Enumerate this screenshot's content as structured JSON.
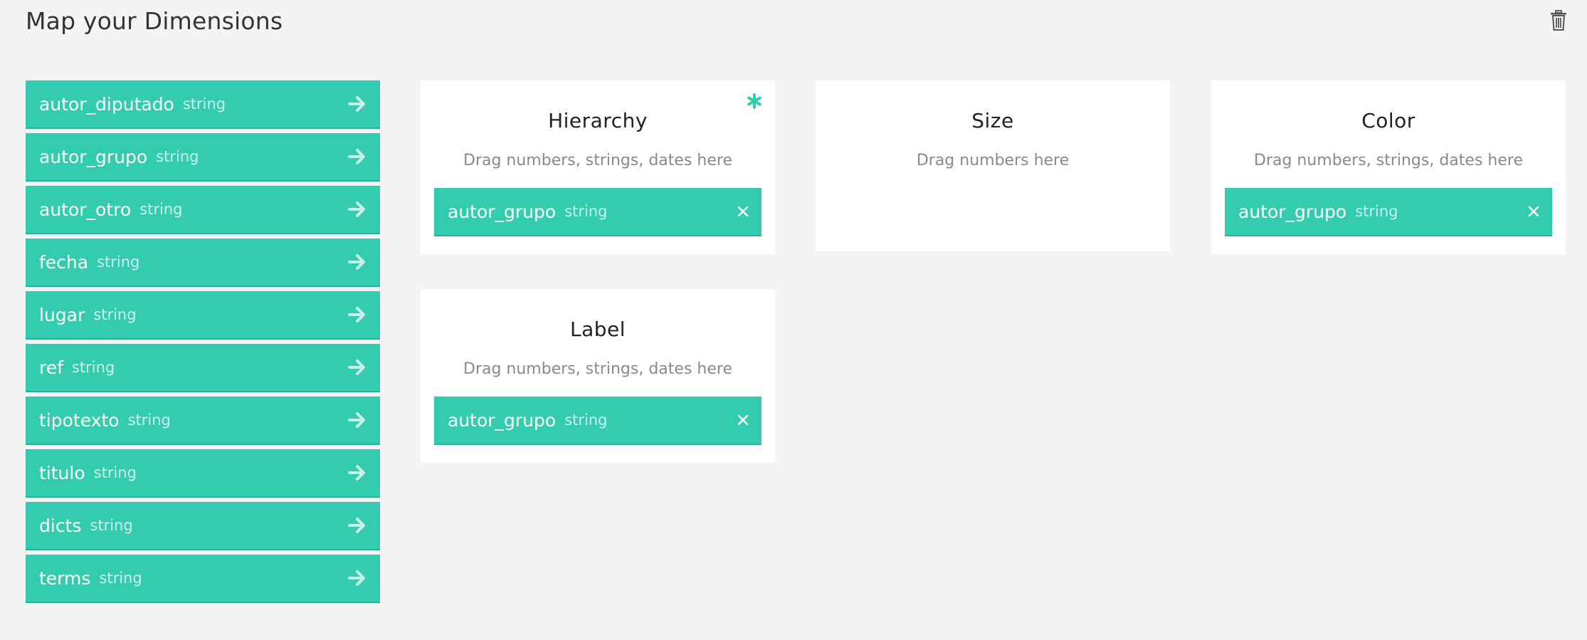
{
  "header": {
    "title": "Map your Dimensions",
    "clear_icon": "trash-icon"
  },
  "dimensions": [
    {
      "name": "autor_diputado",
      "type": "string"
    },
    {
      "name": "autor_grupo",
      "type": "string"
    },
    {
      "name": "autor_otro",
      "type": "string"
    },
    {
      "name": "fecha",
      "type": "string"
    },
    {
      "name": "lugar",
      "type": "string"
    },
    {
      "name": "ref",
      "type": "string"
    },
    {
      "name": "tipotexto",
      "type": "string"
    },
    {
      "name": "titulo",
      "type": "string"
    },
    {
      "name": "dicts",
      "type": "string"
    },
    {
      "name": "terms",
      "type": "string"
    }
  ],
  "mapping": {
    "hierarchy": {
      "title": "Hierarchy",
      "hint": "Drag numbers, strings, dates here",
      "required": true,
      "chip": {
        "name": "autor_grupo",
        "type": "string"
      }
    },
    "size": {
      "title": "Size",
      "hint": "Drag numbers here"
    },
    "color": {
      "title": "Color",
      "hint": "Drag numbers, strings, dates here",
      "chip": {
        "name": "autor_grupo",
        "type": "string"
      }
    },
    "label": {
      "title": "Label",
      "hint": "Drag numbers, strings, dates here",
      "chip": {
        "name": "autor_grupo",
        "type": "string"
      }
    }
  },
  "colors": {
    "accent": "#33ccae",
    "background": "#f4f4f4"
  }
}
